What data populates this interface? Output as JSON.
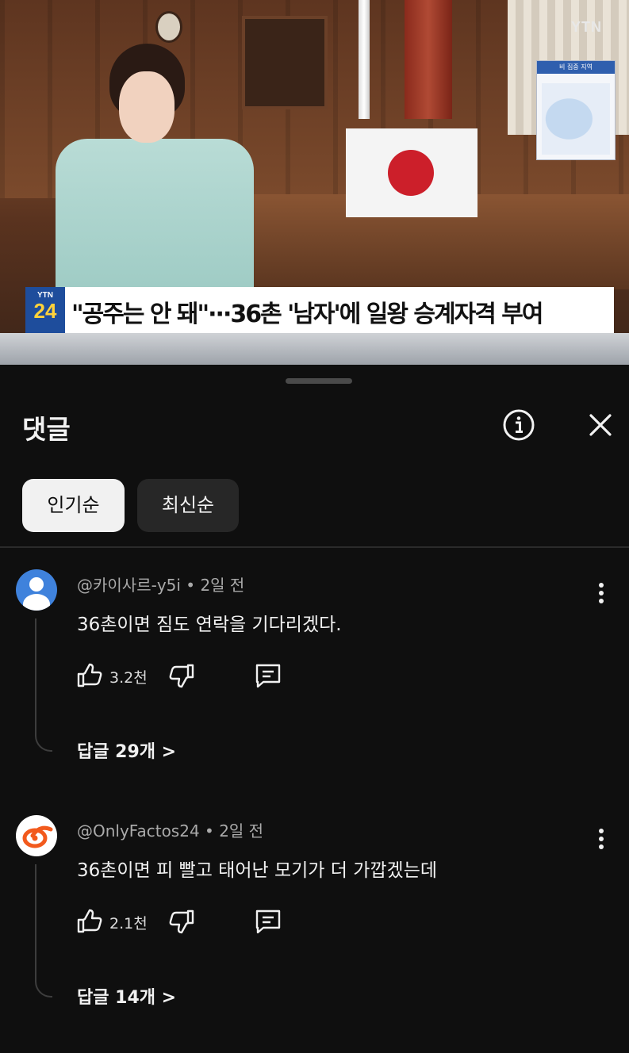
{
  "video": {
    "channel_logo": "YTN",
    "badge_top": "YTN",
    "badge_bottom": "24",
    "headline": "\"공주는 안 돼\"···36촌 '남자'에 일왕 승계자격 부여",
    "map_title": "비 집중 지역"
  },
  "comments_panel": {
    "title": "댓글",
    "sort_chips": [
      {
        "label": "인기순",
        "active": true
      },
      {
        "label": "최신순",
        "active": false
      }
    ],
    "comments": [
      {
        "author": "@카이사르-y5i",
        "time": "2일 전",
        "meta": "@카이사르-y5i • 2일 전",
        "text": "36촌이면 짐도 연락을 기다리겠다.",
        "likes": "3.2천",
        "replies": "답글 29개 >",
        "avatar_icon": "default-user-avatar-icon"
      },
      {
        "author": "@OnlyFactos24",
        "time": "2일 전",
        "meta": "@OnlyFactos24 • 2일 전",
        "text": "36촌이면 피 빨고 태어난 모기가 더 가깝겠는데",
        "likes": "2.1천",
        "replies": "답글 14개 >",
        "avatar_icon": "orange-swirl-avatar-icon"
      }
    ]
  },
  "colors": {
    "background": "#0f0f0f",
    "chip_active": "#f1f1f1",
    "chip_inactive": "#272727",
    "meta_text": "#aaaaaa",
    "ticker_badge": "#1e4d9c",
    "flag_red": "#cc1f2a"
  }
}
